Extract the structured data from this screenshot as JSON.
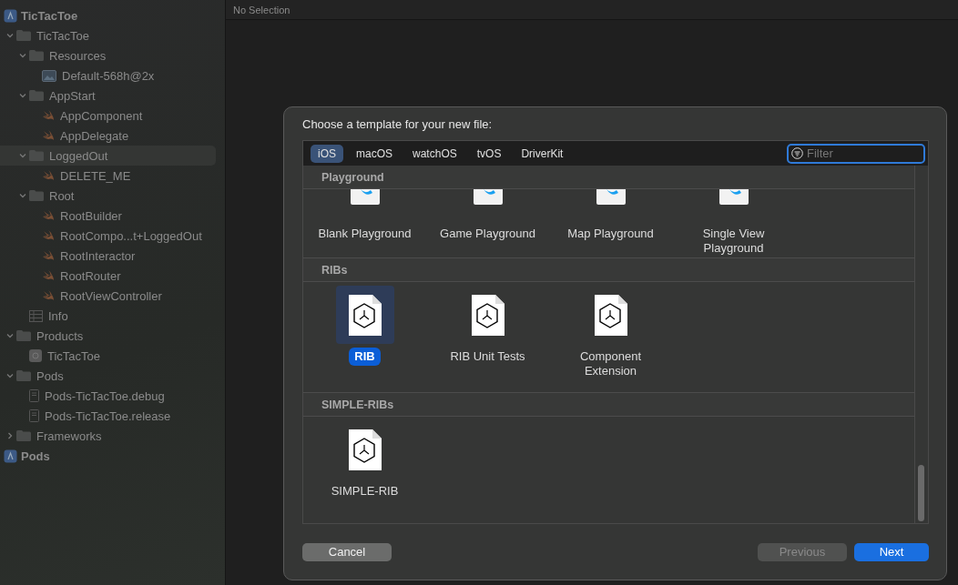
{
  "navigator": {
    "tree": [
      {
        "label": "TicTacToe",
        "kind": "project",
        "selected": false,
        "children": [
          {
            "label": "TicTacToe",
            "kind": "folder",
            "expanded": true,
            "selected": false,
            "children": [
              {
                "label": "Resources",
                "kind": "folder",
                "expanded": true,
                "selected": false,
                "children": [
                  {
                    "label": "Default-568h@2x",
                    "kind": "image",
                    "selected": false
                  }
                ]
              },
              {
                "label": "AppStart",
                "kind": "folder",
                "expanded": true,
                "selected": false,
                "children": [
                  {
                    "label": "AppComponent",
                    "kind": "swift",
                    "selected": false
                  },
                  {
                    "label": "AppDelegate",
                    "kind": "swift",
                    "selected": false
                  }
                ]
              },
              {
                "label": "LoggedOut",
                "kind": "folder",
                "expanded": true,
                "selected": true,
                "children": [
                  {
                    "label": "DELETE_ME",
                    "kind": "swift",
                    "selected": false
                  }
                ]
              },
              {
                "label": "Root",
                "kind": "folder",
                "expanded": true,
                "selected": false,
                "children": [
                  {
                    "label": "RootBuilder",
                    "kind": "swift",
                    "selected": false
                  },
                  {
                    "label": "RootCompo...t+LoggedOut",
                    "kind": "swift",
                    "selected": false
                  },
                  {
                    "label": "RootInteractor",
                    "kind": "swift",
                    "selected": false
                  },
                  {
                    "label": "RootRouter",
                    "kind": "swift",
                    "selected": false
                  },
                  {
                    "label": "RootViewController",
                    "kind": "swift",
                    "selected": false
                  }
                ]
              },
              {
                "label": "Info",
                "kind": "plist",
                "selected": false
              }
            ]
          },
          {
            "label": "Products",
            "kind": "folder",
            "expanded": true,
            "selected": false,
            "children": [
              {
                "label": "TicTacToe",
                "kind": "app",
                "selected": false
              }
            ]
          },
          {
            "label": "Pods",
            "kind": "folder",
            "expanded": true,
            "selected": false,
            "children": [
              {
                "label": "Pods-TicTacToe.debug",
                "kind": "file",
                "selected": false
              },
              {
                "label": "Pods-TicTacToe.release",
                "kind": "file",
                "selected": false
              }
            ]
          },
          {
            "label": "Frameworks",
            "kind": "folder",
            "expanded": false,
            "selected": false
          }
        ]
      },
      {
        "label": "Pods",
        "kind": "project",
        "selected": false
      }
    ]
  },
  "editor": {
    "header": "No Selection"
  },
  "dialog": {
    "title": "Choose a template for your new file:",
    "tabs": [
      {
        "label": "iOS",
        "selected": true
      },
      {
        "label": "macOS",
        "selected": false
      },
      {
        "label": "watchOS",
        "selected": false
      },
      {
        "label": "tvOS",
        "selected": false
      },
      {
        "label": "DriverKit",
        "selected": false
      }
    ],
    "filter": {
      "placeholder": "Filter"
    },
    "sections": [
      {
        "title": "Playground",
        "items": [
          {
            "label": "Blank Playground",
            "kind": "playground",
            "selected": false
          },
          {
            "label": "Game Playground",
            "kind": "playground",
            "selected": false
          },
          {
            "label": "Map Playground",
            "kind": "playground",
            "selected": false
          },
          {
            "label": "Single View Playground",
            "kind": "playground",
            "selected": false
          }
        ]
      },
      {
        "title": "RIBs",
        "items": [
          {
            "label": "RIB",
            "kind": "rib",
            "selected": true
          },
          {
            "label": "RIB Unit Tests",
            "kind": "rib",
            "selected": false
          },
          {
            "label": "Component Extension",
            "kind": "rib",
            "selected": false
          }
        ]
      },
      {
        "title": "SIMPLE-RIBs",
        "items": [
          {
            "label": "SIMPLE-RIB",
            "kind": "rib",
            "selected": false
          }
        ]
      }
    ],
    "buttons": [
      {
        "label": "Cancel",
        "kind": "secondary"
      },
      {
        "label": "Previous",
        "kind": "disabled"
      },
      {
        "label": "Next",
        "kind": "primary"
      }
    ]
  }
}
